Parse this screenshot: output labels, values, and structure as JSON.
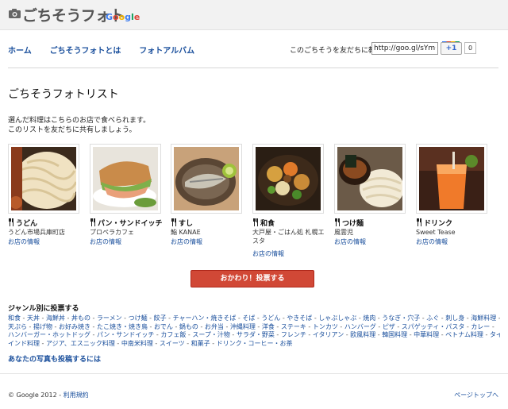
{
  "brand": {
    "logo_text": "ごちそうフォト",
    "google_letters": [
      "G",
      "o",
      "o",
      "g",
      "l",
      "e"
    ],
    "google_colors": [
      "#3c7cf0",
      "#db4437",
      "#f4b400",
      "#3c7cf0",
      "#0f9d58",
      "#db4437"
    ]
  },
  "nav": {
    "items": [
      "ホーム",
      "ごちそうフォトとは",
      "フォトアルバム"
    ]
  },
  "share": {
    "label": "このごちそうを友だちに教える",
    "url_value": "http://goo.gl/sYm6y",
    "plusone_label": "+1",
    "count": "0"
  },
  "main": {
    "title": "ごちそうフォトリスト",
    "intro_line1": "選んだ料理はこちらのお店で食べられます。",
    "intro_line2": "このリストを友だちに共有しましょう。"
  },
  "dishes": [
    {
      "category": "うどん",
      "shop": "うどん市場兵庫町店",
      "link": "お店の情報"
    },
    {
      "category": "パン・サンドイッチ",
      "shop": "プロペラカフェ",
      "link": "お店の情報"
    },
    {
      "category": "すし",
      "shop": "鮨 KANAE",
      "link": "お店の情報"
    },
    {
      "category": "和食",
      "shop": "大戸屋・ごはん処 札幌エスタ",
      "link": "お店の情報"
    },
    {
      "category": "つけ麺",
      "shop": "風雲児",
      "link": "お店の情報"
    },
    {
      "category": "ドリンク",
      "shop": "Sweet Tease",
      "link": "お店の情報"
    }
  ],
  "vote_button": "おかわり！投票する",
  "genres": {
    "title": "ジャンル別に投票する",
    "lines": [
      [
        "和食",
        "天丼",
        "海鮮丼",
        "丼もの",
        "ラーメン",
        "つけ麺",
        "餃子",
        "チャーハン・焼きそば",
        "そば",
        "うどん",
        "やきそば",
        "しゃぶしゃぶ",
        "焼肉",
        "うなぎ・穴子",
        "ふぐ",
        "刺し身",
        "海鮮料理",
        "すし"
      ],
      [
        "天ぷら",
        "揚げ物",
        "お好み焼き",
        "たこ焼き・焼き鳥",
        "おでん",
        "鍋もの",
        "お弁当",
        "沖縄料理",
        "洋食",
        "ステーキ",
        "トンカツ",
        "ハンバーグ",
        "ピザ",
        "スパゲッティ・パスタ",
        "カレー"
      ],
      [
        "ハンバーガー・ホットドッグ",
        "パン・サンドイッチ",
        "カフェ飯",
        "スープ・汁物",
        "サラダ・野菜",
        "フレンチ",
        "イタリアン",
        "欧風料理",
        "韓国料理",
        "中華料理",
        "ベトナム料理",
        "タイ料理"
      ],
      [
        "インド料理",
        "アジア、エスニック料理",
        "中南米料理",
        "スイーツ",
        "和菓子",
        "ドリンク・コーヒー・お茶"
      ]
    ],
    "post_link": "あなたの写真も投稿するには"
  },
  "footer": {
    "copyright": "© Google 2012 - ",
    "terms": "利用規約",
    "page_top": "ページトップへ"
  }
}
